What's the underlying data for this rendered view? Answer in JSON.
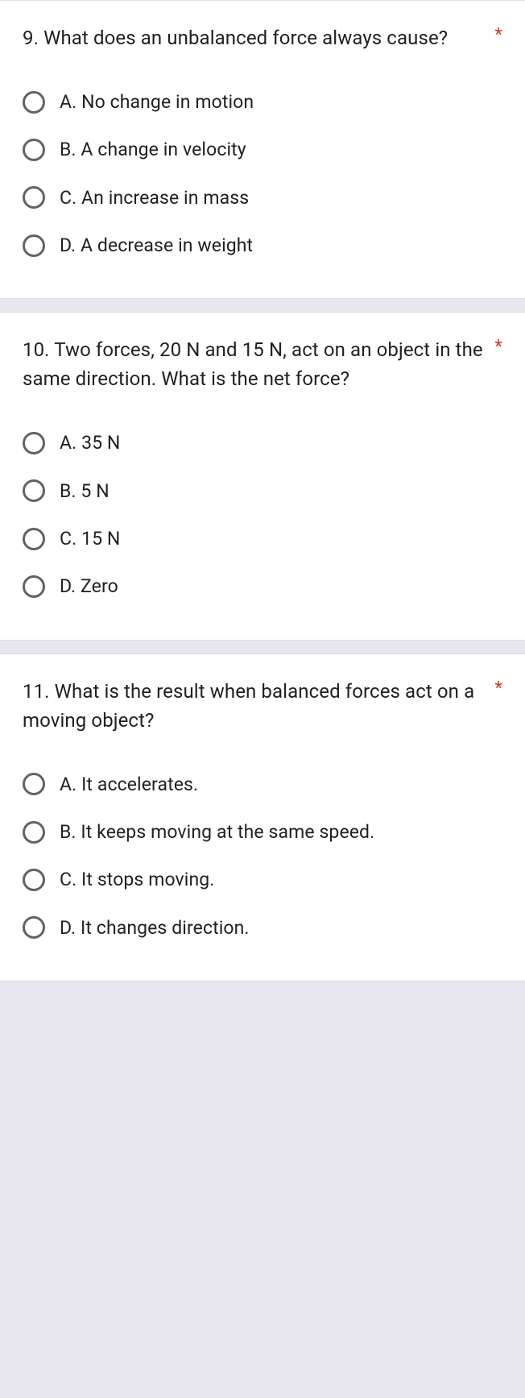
{
  "questions": [
    {
      "prompt": "9. What does an unbalanced force always cause?",
      "required": "*",
      "options": [
        "A. No change in motion",
        "B. A change in velocity",
        "C. An increase in mass",
        "D. A decrease in weight"
      ]
    },
    {
      "prompt": "10. Two forces, 20 N and 15 N, act on an object in the same direction. What is the net force?",
      "required": "*",
      "options": [
        "A. 35 N",
        "B. 5 N",
        "C. 15 N",
        "D. Zero"
      ]
    },
    {
      "prompt": "11. What is the result when balanced forces act on a moving object?",
      "required": "*",
      "options": [
        "A. It accelerates.",
        "B. It keeps moving at the same speed.",
        "C. It stops moving.",
        "D. It changes direction."
      ]
    }
  ]
}
